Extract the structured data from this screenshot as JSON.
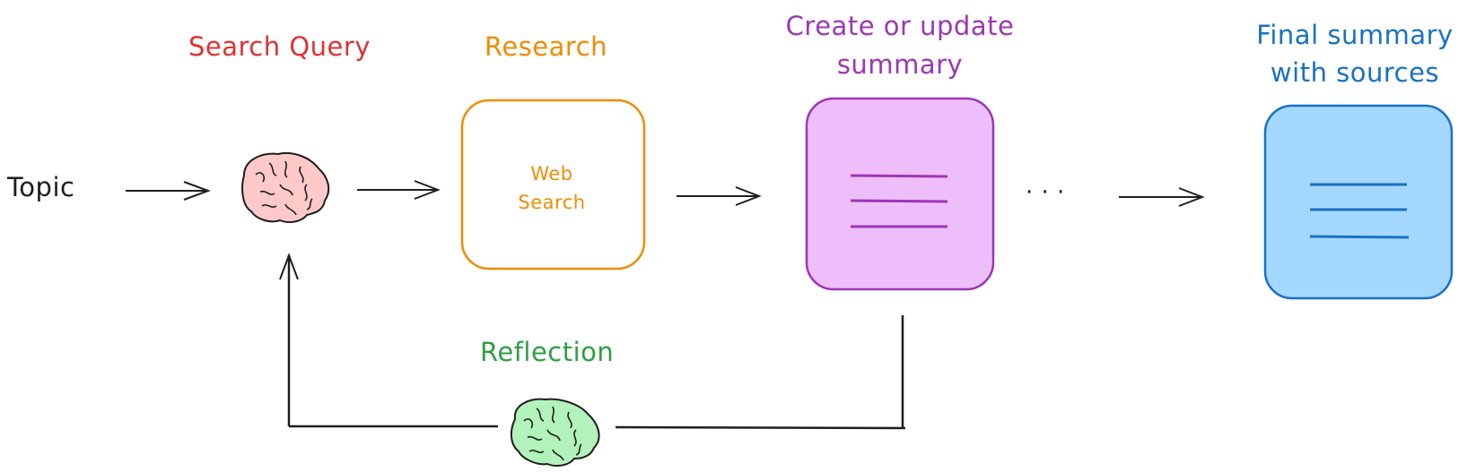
{
  "diagram": {
    "nodes": {
      "topic": {
        "label": "Topic",
        "color": "#1e1e1e"
      },
      "search_query": {
        "label": "Search Query",
        "color": "#e03131",
        "icon": "brain-icon",
        "fill": "#ffc9c9"
      },
      "research": {
        "label": "Research",
        "color": "#f08c00",
        "box_text_line1": "Web",
        "box_text_line2": "Search",
        "fill": "#ffffff"
      },
      "summary": {
        "label_line1": "Create or update",
        "label_line2": "summary",
        "color": "#9c36b5",
        "icon": "document-icon",
        "fill": "#eebefa"
      },
      "final": {
        "label_line1": "Final summary",
        "label_line2": "with sources",
        "color": "#1971c2",
        "icon": "document-icon",
        "fill": "#a5d8ff"
      },
      "reflection": {
        "label": "Reflection",
        "color": "#2f9e44",
        "icon": "brain-icon",
        "fill": "#b2f2bb"
      }
    },
    "ellipsis": "· · ·",
    "edges": [
      {
        "from": "topic",
        "to": "search_query"
      },
      {
        "from": "search_query",
        "to": "research"
      },
      {
        "from": "research",
        "to": "summary"
      },
      {
        "from": "summary",
        "to": "ellipsis"
      },
      {
        "from": "ellipsis",
        "to": "final"
      },
      {
        "from": "summary",
        "to": "reflection"
      },
      {
        "from": "reflection",
        "to": "search_query"
      }
    ]
  }
}
